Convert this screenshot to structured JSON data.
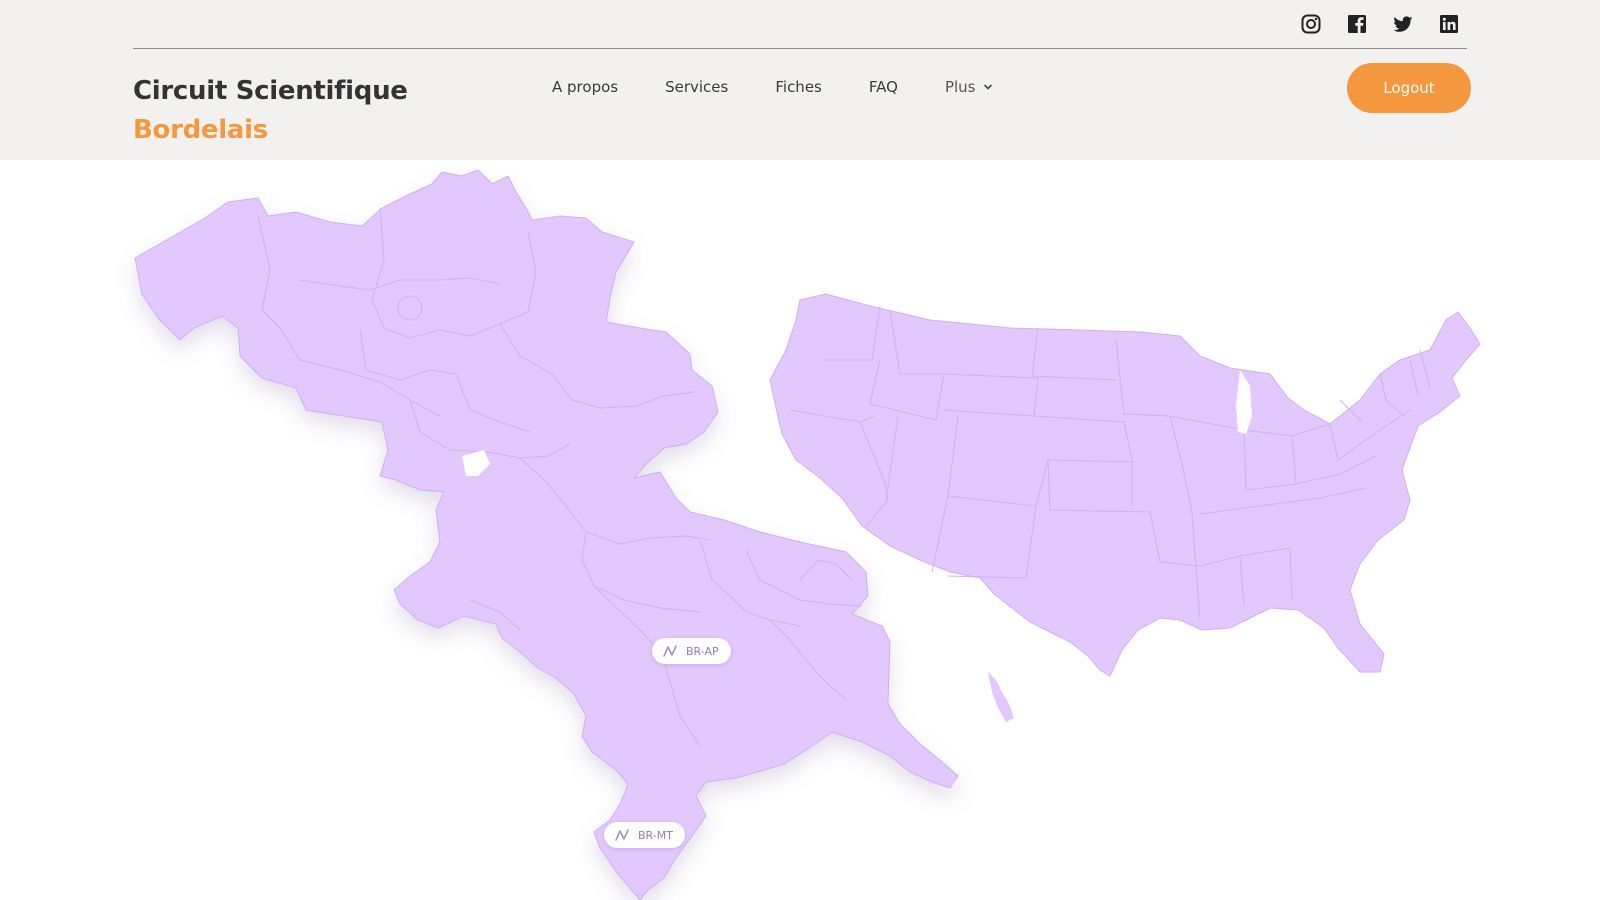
{
  "header": {
    "social": [
      {
        "icon": "instagram-icon"
      },
      {
        "icon": "facebook-icon"
      },
      {
        "icon": "twitter-icon"
      },
      {
        "icon": "linkedin-icon"
      }
    ],
    "brand": {
      "line1": "Circuit Scientifique",
      "line2": "Bordelais"
    },
    "nav": [
      {
        "label": "A propos"
      },
      {
        "label": "Services"
      },
      {
        "label": "Fiches"
      },
      {
        "label": "FAQ"
      },
      {
        "label": "Plus"
      }
    ],
    "logout_label": "Logout"
  },
  "map": {
    "region_labels": [
      {
        "code": "BR-AP",
        "icon": "trend-icon"
      },
      {
        "code": "BR-MT",
        "icon": "trend-icon"
      }
    ]
  },
  "colors": {
    "accent": "#f4973e",
    "topbar_bg": "#f2f1f0",
    "map_fill": "#e2c8fd",
    "map_stroke": "#cdb2ee",
    "pill_text": "#8e7bbf"
  }
}
